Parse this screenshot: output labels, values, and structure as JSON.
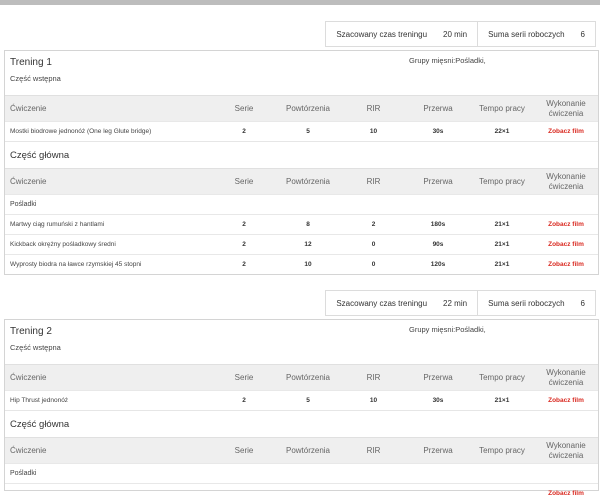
{
  "page": {
    "summary_time_label": "Szacowany czas treningu",
    "summary_sets_label": "Suma serii roboczych"
  },
  "columns": {
    "exercise": "Ćwiczenie",
    "sets": "Serie",
    "reps": "Powtórzenia",
    "rir": "RIR",
    "rest": "Przerwa",
    "tempo": "Tempo pracy",
    "execution": "Wykonanie ćwiczenia"
  },
  "video_link_label": "Zobacz film",
  "trainings": [
    {
      "title": "Trening 1",
      "muscle_groups": "Grupy mięsni:Pośladki,",
      "time": "20 min",
      "sets_total": "6",
      "intro_label": "Część wstępna",
      "warmup": [
        {
          "name": "Mostki biodrowe jednonóż (One leg Glute bridge)",
          "sets": "2",
          "reps": "5",
          "rir": "10",
          "rest": "30s",
          "tempo": "22×1"
        }
      ],
      "main_label": "Część główna",
      "main_group": "Pośladki",
      "main": [
        {
          "name": "Martwy ciąg rumuński z hantlami",
          "sets": "2",
          "reps": "8",
          "rir": "2",
          "rest": "180s",
          "tempo": "21×1"
        },
        {
          "name": "Kickback okrężny pośladkowy średni",
          "sets": "2",
          "reps": "12",
          "rir": "0",
          "rest": "90s",
          "tempo": "21×1"
        },
        {
          "name": "Wyprosty biodra na ławce rzymskiej 45 stopni",
          "sets": "2",
          "reps": "10",
          "rir": "0",
          "rest": "120s",
          "tempo": "21×1"
        }
      ]
    },
    {
      "title": "Trening 2",
      "muscle_groups": "Grupy mięsni:Pośladki,",
      "time": "22 min",
      "sets_total": "6",
      "intro_label": "Część wstępna",
      "warmup": [
        {
          "name": "Hip Thrust jednonóż",
          "sets": "2",
          "reps": "5",
          "rir": "10",
          "rest": "30s",
          "tempo": "21×1"
        }
      ],
      "main_label": "Część główna",
      "main_group": "Pośladki",
      "main": []
    }
  ]
}
